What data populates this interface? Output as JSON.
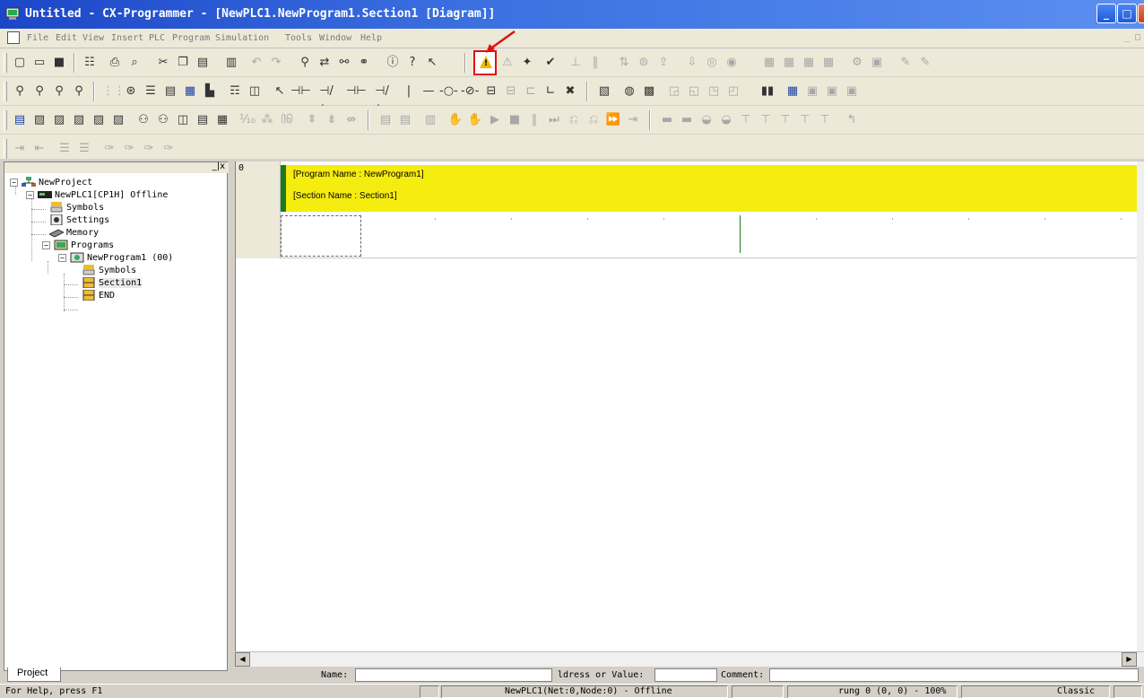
{
  "window": {
    "title": "Untitled - CX-Programmer - [NewPLC1.NewProgram1.Section1 [Diagram]]",
    "controls": {
      "minimize": "_",
      "maximize": "□",
      "close": "✕"
    }
  },
  "menu": {
    "items": [
      "File",
      "Edit",
      "View",
      "Insert",
      "PLC",
      "Program",
      "Simulation",
      "Tools",
      "Window",
      "Help"
    ],
    "mdi_controls": "_ □"
  },
  "toolbars": {
    "row1_icons": [
      "new-icon",
      "open-icon",
      "save-icon",
      "properties-icon",
      "print-icon",
      "print-preview-icon",
      "cut-icon",
      "copy-icon",
      "paste-icon",
      "clipboard-icon",
      "undo-icon",
      "redo-icon",
      "find-icon",
      "replace-icon",
      "cross-ref-icon",
      "address-ref-icon",
      "info-icon",
      "help-icon",
      "whats-this-icon",
      "warning-icon",
      "compile-icon",
      "compile-all-icon",
      "check-icon",
      "online-icon",
      "pause-icon",
      "transfer-icon",
      "compare-icon",
      "upload-icon",
      "download-icon",
      "monitor-icon",
      "watch-icon",
      "data-trace-icon",
      "time-chart-icon",
      "memory-icon",
      "io-table-icon",
      "setup-icon",
      "expansion-icon"
    ],
    "row2_icons": [
      "zoom-in-icon",
      "zoom-to-fit-icon",
      "zoom-icon",
      "zoom-out-icon",
      "grid-icon",
      "symbols-icon",
      "list-icon",
      "mnemonic-icon",
      "ladder-icon",
      "st-icon",
      "comment-icon",
      "io-comment-icon",
      "select-icon",
      "contact-no-icon",
      "contact-nc-icon",
      "contact-or-icon",
      "contact-or-nc-icon",
      "vertical-line-icon",
      "horizontal-line-icon",
      "coil-icon",
      "coil-nc-icon",
      "instruction-icon",
      "bit-counter-icon",
      "fb-icon",
      "wire-icon",
      "delete-icon",
      "block-icon",
      "data-view-icon",
      "memory-view-icon",
      "bits-icon",
      "flags-icon",
      "tasks-icon",
      "search-icon",
      "local-icon",
      "global-icon",
      "sections-icon",
      "edit-icon"
    ],
    "row3_icons": [
      "project-window-icon",
      "output-window-icon",
      "watch-window-icon",
      "address-window-icon",
      "prog-ref-icon",
      "properties-window-icon",
      "cross-ref-window-icon",
      "simulation-icon",
      "diagram-icon",
      "sfc-icon",
      "table-icon",
      "decimal-icon",
      "binary-icon",
      "hex-icon",
      "force-on-icon",
      "force-off-icon",
      "force-cancel-icon",
      "online-edit-icon",
      "monitor-on-icon",
      "monitor-off-icon",
      "step-in-icon",
      "step-over-icon",
      "run-icon",
      "stop-icon",
      "pause-sim-icon",
      "step-icon",
      "break-icon",
      "break-clear-icon",
      "fast-forward-icon",
      "run-to-icon",
      "io-1-icon",
      "io-2-icon",
      "io-3-icon",
      "io-4-icon",
      "io-5-icon",
      "io-6-icon",
      "io-7-icon",
      "io-8-icon",
      "return-icon"
    ],
    "row4_icons": [
      "indent-icon",
      "outdent-icon",
      "comment-block-icon",
      "uncomment-block-icon",
      "bookmark-icon",
      "bookmark-next-icon",
      "bookmark-prev-icon",
      "bookmark-clear-icon"
    ]
  },
  "tree": {
    "header_controls": "_|x",
    "nodes": [
      {
        "label": "NewProject",
        "expander": "−",
        "icon": "project-icon"
      },
      {
        "label": "NewPLC1[CP1H] Offline",
        "expander": "−",
        "icon": "plc-icon"
      },
      {
        "label": "Symbols",
        "icon": "symbols-icon"
      },
      {
        "label": "Settings",
        "icon": "settings-icon"
      },
      {
        "label": "Memory",
        "icon": "memory-icon"
      },
      {
        "label": "Programs",
        "expander": "−",
        "icon": "programs-icon"
      },
      {
        "label": "NewProgram1 (00)",
        "expander": "−",
        "icon": "program-icon"
      },
      {
        "label": "Symbols",
        "icon": "symbols-icon"
      },
      {
        "label": "Section1",
        "icon": "section-icon"
      },
      {
        "label": "END",
        "icon": "section-icon"
      }
    ],
    "tab": "Project"
  },
  "diagram": {
    "rung_number": "0",
    "program_name_line": "[Program Name : NewProgram1]",
    "section_name_line": "[Section Name : Section1]"
  },
  "property_bar": {
    "name_label": "Name:",
    "address_label": "ldress or Value:",
    "comment_label": "Comment:"
  },
  "status": {
    "help": "For Help, press F1",
    "connection": "NewPLC1(Net:0,Node:0) - Offline",
    "position": "rung 0 (0, 0)  - 100%",
    "mode": "Classic"
  },
  "colors": {
    "title_bar": "#1c46c8",
    "comment_band": "#f5ec10",
    "rail": "#1c7a1c",
    "highlight": "#e01010"
  }
}
